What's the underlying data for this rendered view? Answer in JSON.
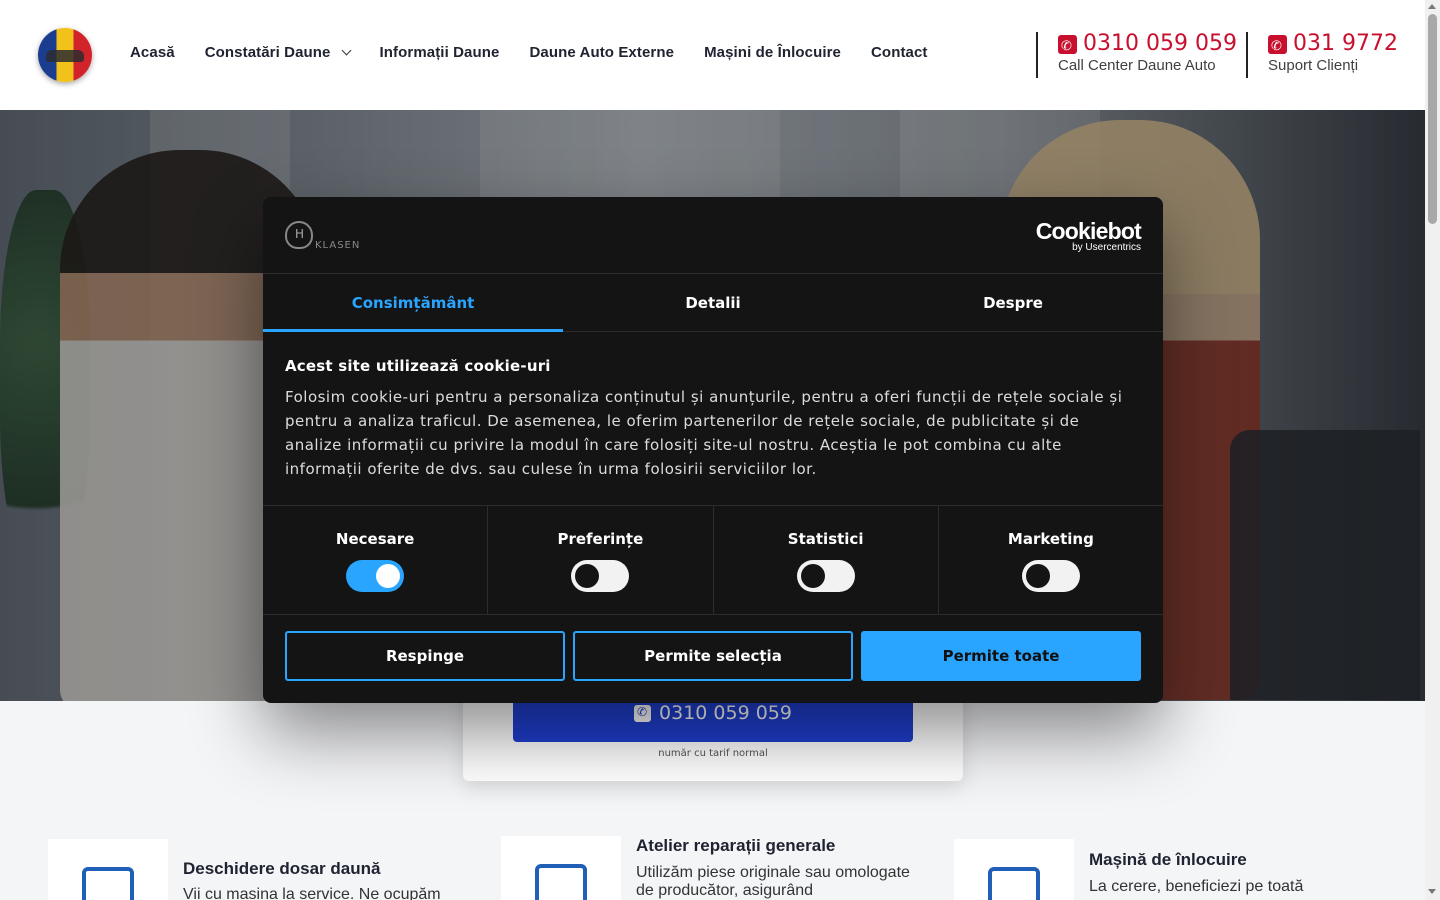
{
  "header": {
    "nav": [
      {
        "label": "Acasă",
        "has_dropdown": false
      },
      {
        "label": "Constatări Daune",
        "has_dropdown": true
      },
      {
        "label": "Informații Daune",
        "has_dropdown": false
      },
      {
        "label": "Daune Auto Externe",
        "has_dropdown": false
      },
      {
        "label": "Mașini de Înlocuire",
        "has_dropdown": false
      },
      {
        "label": "Contact",
        "has_dropdown": false
      }
    ],
    "contacts": [
      {
        "phone": "0310 059 059",
        "label": "Call Center Daune Auto"
      },
      {
        "phone": "031 9772",
        "label": "Suport Clienți"
      }
    ],
    "accent_color": "#c8102e"
  },
  "callcard": {
    "phone": "0310 059 059",
    "note": "număr cu tarif normal",
    "button_color": "#1f3fd1"
  },
  "features": [
    {
      "title": "Deschidere dosar daună",
      "text": "Vii cu masina la service. Ne ocupăm",
      "icon": "clipboard-car-icon"
    },
    {
      "title": "Atelier reparații generale",
      "text": "Utilizăm piese originale sau omologate de producător, asigurând",
      "icon": "car-lift-icon"
    },
    {
      "title": "Mașină de înlocuire",
      "text": "La cerere, beneficiezi pe toată",
      "icon": "car-icon"
    }
  ],
  "cookie": {
    "brand_text": "KLASEN",
    "cookiebot_name": "Cookiebot",
    "cookiebot_sub": "by Usercentrics",
    "tabs": [
      "Consimțământ",
      "Detalii",
      "Despre"
    ],
    "active_tab": 0,
    "title": "Acest site utilizează cookie-uri",
    "text": "Folosim cookie-uri pentru a personaliza conținutul și anunțurile, pentru a oferi funcții de rețele sociale și pentru a analiza traficul. De asemenea, le oferim partenerilor de rețele sociale, de publicitate și de analize informații cu privire la modul în care folosiți site-ul nostru. Aceștia le pot combina cu alte informații oferite de dvs. sau culese în urma folosirii serviciilor lor.",
    "toggles": [
      {
        "label": "Necesare",
        "on": true
      },
      {
        "label": "Preferințe",
        "on": false
      },
      {
        "label": "Statistici",
        "on": false
      },
      {
        "label": "Marketing",
        "on": false
      }
    ],
    "buttons": {
      "reject": "Respinge",
      "allow_selection": "Permite selecția",
      "allow_all": "Permite toate"
    },
    "accent_color": "#2aa5ff"
  }
}
